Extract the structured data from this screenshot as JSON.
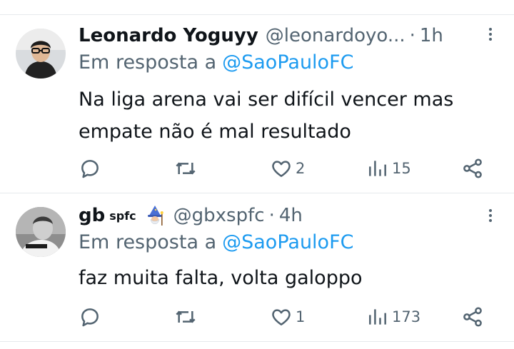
{
  "tweets": [
    {
      "name": "Leonardo Yoguyy",
      "handle": "@leonardoyo...",
      "dot": "·",
      "time": "1h",
      "reply_prefix": "Em resposta a",
      "reply_mention": "@SaoPauloFC",
      "text_lines": [
        "Na liga arena vai ser difícil vencer mas",
        "empate não é mal resultado"
      ],
      "likes": "2",
      "views": "15"
    },
    {
      "name": "gb",
      "name_sup": "spfc",
      "name_emoji": "mage-emoji",
      "handle": "@gbxspfc",
      "dot": "·",
      "time": "4h",
      "reply_prefix": "Em resposta a",
      "reply_mention": "@SaoPauloFC",
      "text_lines": [
        "faz muita falta, volta galoppo"
      ],
      "likes": "1",
      "views": "173"
    }
  ],
  "icons": {
    "reply": "reply-icon",
    "retweet": "retweet-icon",
    "like": "heart-icon",
    "views": "views-icon",
    "share": "share-icon",
    "more": "more-vertical-icon"
  },
  "colors": {
    "text": "#0f1419",
    "secondary": "#536471",
    "accent": "#1d9bf0",
    "divider": "#e6e9ec"
  }
}
